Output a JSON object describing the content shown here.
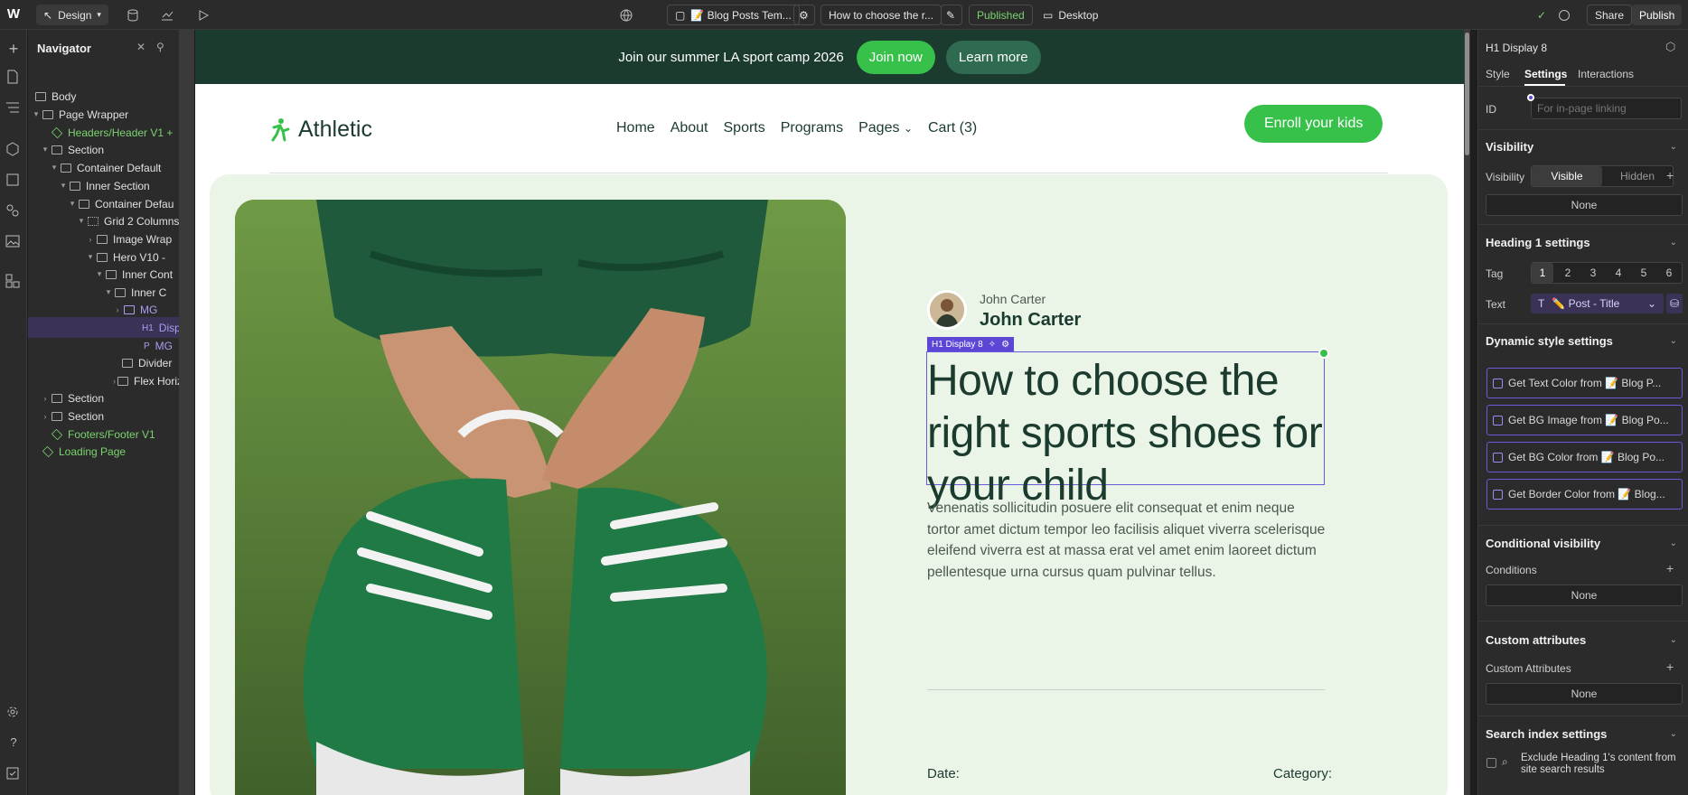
{
  "topbar": {
    "mode_label": "Design",
    "page_tab": "📝 Blog Posts Tem...",
    "item_tab": "How to choose the r...",
    "status": "Published",
    "breakpoint": "Desktop",
    "share_label": "Share",
    "publish_label": "Publish"
  },
  "navigator": {
    "title": "Navigator",
    "rows": [
      {
        "label": "Body"
      },
      {
        "label": "Page Wrapper"
      },
      {
        "label": "Headers/Header V1 +"
      },
      {
        "label": "Section"
      },
      {
        "label": "Container Default"
      },
      {
        "label": "Inner Section"
      },
      {
        "label": "Container Defau"
      },
      {
        "label": "Grid 2 Columns"
      },
      {
        "label": "Image Wrap"
      },
      {
        "label": "Hero V10 -"
      },
      {
        "label": "Inner Cont"
      },
      {
        "label": "Inner C"
      },
      {
        "label": "MG"
      },
      {
        "label": "Disp"
      },
      {
        "label": "MG"
      },
      {
        "label": "Divider"
      },
      {
        "label": "Flex Horiz"
      },
      {
        "label": "Section"
      },
      {
        "label": "Section"
      },
      {
        "label": "Footers/Footer V1"
      },
      {
        "label": "Loading Page"
      }
    ]
  },
  "site": {
    "promo_text": "Join our summer LA sport camp 2026",
    "join_now": "Join now",
    "learn_more": "Learn more",
    "logo": "Athletic",
    "menu": [
      "Home",
      "About",
      "Sports",
      "Programs",
      "Pages",
      "Cart (3)"
    ],
    "enroll": "Enroll your kids",
    "author_small": "John Carter",
    "author_big": "John Carter",
    "sel_tag": "H1  Display 8",
    "headline": "How to choose the right sports shoes for your child",
    "excerpt": "Venenatis sollicitudin posuere elit consequat et enim neque tortor amet dictum tempor leo facilisis aliquet viverra scelerisque eleifend viverra est at massa erat vel amet enim laoreet dictum pellentesque urna cursus quam pulvinar tellus.",
    "date_label": "Date:",
    "category_label": "Category:"
  },
  "panel": {
    "element": "H1  Display 8",
    "tabs": [
      "Style",
      "Settings",
      "Interactions"
    ],
    "id_label": "ID",
    "id_placeholder": "For in-page linking",
    "visibility_head": "Visibility",
    "visibility_label": "Visibility",
    "visible": "Visible",
    "hidden": "Hidden",
    "none": "None",
    "heading_head": "Heading 1 settings",
    "tag_label": "Tag",
    "tag_options": [
      "1",
      "2",
      "3",
      "4",
      "5",
      "6"
    ],
    "text_label": "Text",
    "text_value": "✏️ Post - Title",
    "dynamic_head": "Dynamic style settings",
    "dynamic": [
      "Get Text Color from  📝 Blog P...",
      "Get BG Image from  📝 Blog Po...",
      "Get BG Color from  📝 Blog Po...",
      "Get Border Color from  📝 Blog..."
    ],
    "cond_head": "Conditional visibility",
    "conditions_label": "Conditions",
    "custom_head": "Custom attributes",
    "custom_label": "Custom Attributes",
    "search_head": "Search index settings",
    "search_text": "Exclude Heading 1's content from site search results"
  }
}
